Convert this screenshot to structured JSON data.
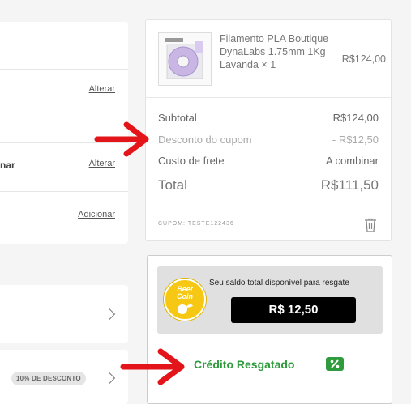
{
  "address": {
    "alter_label_1": "Alterar",
    "shipping_label": "nar",
    "alter_label_2": "Alterar",
    "add_label": "Adicionar"
  },
  "discount": {
    "badge": "10% DE DESCONTO"
  },
  "summary": {
    "product": {
      "name": "Filamento PLA Boutique DynaLabs 1.75mm 1Kg Lavanda × 1",
      "price": "R$124,00"
    },
    "subtotal_label": "Subtotal",
    "subtotal_value": "R$124,00",
    "discount_label": "Desconto do cupom",
    "discount_value": "- R$12,50",
    "shipping_label": "Custo de frete",
    "shipping_value": "A combinar",
    "total_label": "Total",
    "total_value": "R$111,50",
    "coupon_code": "CUPOM: TESTE122436"
  },
  "reward": {
    "coin_line1": "Beet",
    "coin_line2": "Coin",
    "balance_label": "Seu saldo total disponível para resgate",
    "balance_value": "R$ 12,50",
    "credit_label": "Crédito Resgatado"
  },
  "colors": {
    "accent_green": "#2e9b3c",
    "arrow_red": "#e3151a",
    "coin_yellow": "#f7c813"
  }
}
